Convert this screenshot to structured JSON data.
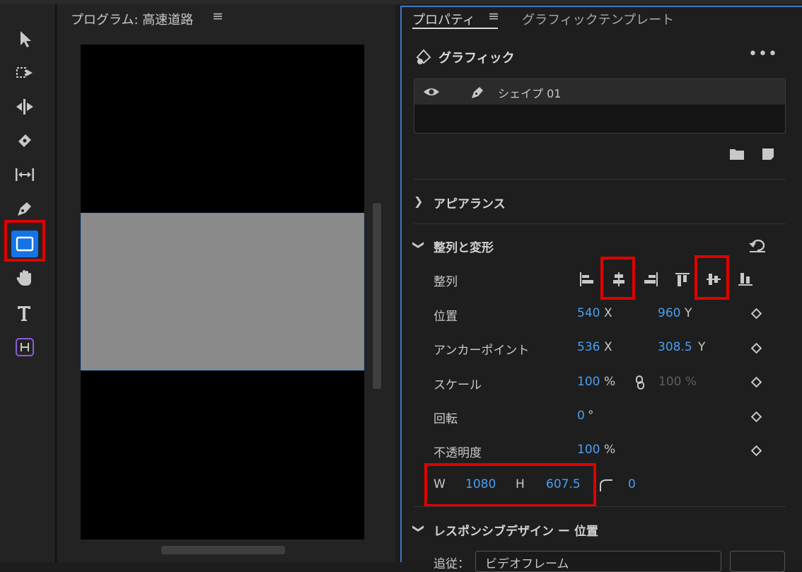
{
  "program_monitor": {
    "title": "プログラム: 高速道路",
    "menu_glyph": "≡"
  },
  "toolbar": {
    "tools": [
      {
        "name": "selection-tool",
        "icon": "arrow-pointer-icon"
      },
      {
        "name": "track-select-tool",
        "icon": "track-select-icon"
      },
      {
        "name": "ripple-edit-tool",
        "icon": "ripple-edit-icon"
      },
      {
        "name": "razor-tool",
        "icon": "razor-icon"
      },
      {
        "name": "slip-tool",
        "icon": "slip-icon"
      },
      {
        "name": "pen-tool",
        "icon": "pen-icon"
      },
      {
        "name": "rectangle-tool",
        "icon": "rectangle-icon",
        "active": true
      },
      {
        "name": "hand-tool",
        "icon": "hand-icon"
      },
      {
        "name": "type-tool",
        "icon": "type-icon"
      },
      {
        "name": "remix-tool",
        "icon": "remix-icon"
      }
    ]
  },
  "properties": {
    "tab_active": "プロパティ",
    "tab_menu": "≡",
    "tab_inactive": "グラフィックテンプレート",
    "section_title": "グラフィック",
    "more": "•••",
    "layer_name": "シェイプ 01",
    "appearance_label": "アピアランス",
    "align_transform_label": "整列と変形",
    "align_label": "整列",
    "rows": {
      "position": {
        "label": "位置",
        "x": "540",
        "x_unit": "X",
        "y": "960",
        "y_unit": "Y"
      },
      "anchor": {
        "label": "アンカーポイント",
        "x": "536",
        "x_unit": "X",
        "y": "308.5",
        "y_unit": "Y"
      },
      "scale": {
        "label": "スケール",
        "value": "100",
        "unit": "%",
        "linked_value": "100 %"
      },
      "rotation": {
        "label": "回転",
        "value": "0",
        "unit": "°"
      },
      "opacity": {
        "label": "不透明度",
        "value": "100",
        "unit": "%"
      }
    },
    "size": {
      "w_label": "W",
      "w_value": "1080",
      "h_label": "H",
      "h_value": "607.5",
      "corner_value": "0"
    },
    "responsive_label": "レスポンシブデザイン ー 位置",
    "follow_label": "追従：",
    "follow_value": "ビデオフレーム"
  },
  "colors": {
    "accent": "#1473e6",
    "value_blue": "#4a9ef0",
    "highlight_red": "#e00000",
    "panel_border": "#3d78c7"
  }
}
